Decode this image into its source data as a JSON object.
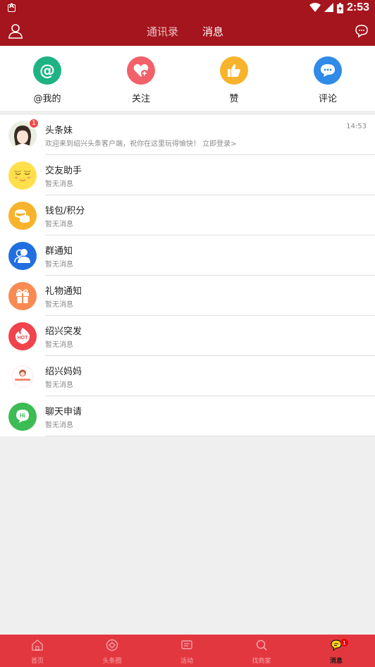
{
  "status_bar": {
    "time": "2:53"
  },
  "header": {
    "tabs": [
      {
        "label": "通讯录"
      },
      {
        "label": "消息"
      }
    ],
    "active_tab": "消息"
  },
  "quick_actions": [
    {
      "label": "@我的",
      "icon": "at-icon",
      "color": "#1fb384"
    },
    {
      "label": "关注",
      "icon": "heart-plus-icon",
      "color": "#f2606a"
    },
    {
      "label": "赞",
      "icon": "thumbs-up-icon",
      "color": "#f7b32b"
    },
    {
      "label": "评论",
      "icon": "chat-bubble-icon",
      "color": "#2f8ae8"
    }
  ],
  "messages": [
    {
      "name": "头条妹",
      "subtitle": "欢迎来到绍兴头条客户端，祝你在这里玩得愉快！ 立即登录>",
      "time": "14:53",
      "badge": "1",
      "icon": "girl-avatar"
    },
    {
      "name": "交友助手",
      "subtitle": "暂无消息",
      "icon": "smile-face-icon",
      "color": "#ffe04a"
    },
    {
      "name": "钱包/积分",
      "subtitle": "暂无消息",
      "icon": "coins-icon",
      "color": "#f7b32b"
    },
    {
      "name": "群通知",
      "subtitle": "暂无消息",
      "icon": "group-icon",
      "color": "#1f6fe0"
    },
    {
      "name": "礼物通知",
      "subtitle": "暂无消息",
      "icon": "gift-icon",
      "color": "#f98a52"
    },
    {
      "name": "绍兴突发",
      "subtitle": "暂无消息",
      "icon": "hot-icon",
      "color": "#f0434b"
    },
    {
      "name": "绍兴妈妈",
      "subtitle": "暂无消息",
      "icon": "mama-logo-icon"
    },
    {
      "name": "聊天申请",
      "subtitle": "暂无消息",
      "icon": "hi-icon",
      "color": "#3dbb55"
    }
  ],
  "bottom_nav": [
    {
      "label": "首页",
      "icon": "home-icon"
    },
    {
      "label": "头条圈",
      "icon": "circle-icon"
    },
    {
      "label": "活动",
      "icon": "activity-icon"
    },
    {
      "label": "找商家",
      "icon": "search-icon"
    },
    {
      "label": "消息",
      "icon": "message-icon",
      "badge": "1",
      "active": true
    }
  ],
  "colors": {
    "header_bg": "#a5151d",
    "nav_bg": "#e3373f"
  }
}
